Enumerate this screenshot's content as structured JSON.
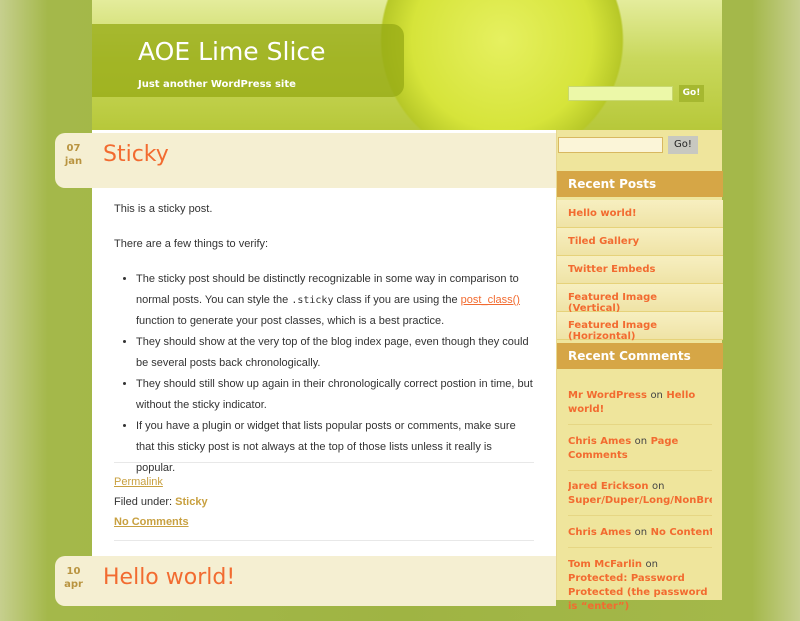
{
  "site": {
    "title": "AOE Lime Slice",
    "tagline": "Just another WordPress site",
    "search_button": "Go!"
  },
  "posts": [
    {
      "day": "07",
      "month": "jan",
      "title": "Sticky",
      "intro": "This is a sticky post.",
      "lead": "There are a few things to verify:",
      "bullets": {
        "b1_pre": "The sticky post should be distinctly recognizable in some way in comparison to normal posts. You can style the ",
        "b1_code": ".sticky",
        "b1_mid": " class if you are using the ",
        "b1_link": "post_class()",
        "b1_post": " function to generate your post classes, which is a best practice.",
        "b2": "They should show at the very top of the blog index page, even though they could be several posts back chronologically.",
        "b3": "They should still show up again in their chronologically correct postion in time, but without the sticky indicator.",
        "b4": "If you have a plugin or widget that lists popular posts or comments, make sure that this sticky post is not always at the top of those lists unless it really is popular."
      },
      "permalink": "Permalink",
      "filed_label": "Filed under:",
      "category": "Sticky",
      "comments": "No Comments"
    },
    {
      "day": "10",
      "month": "apr",
      "title": "Hello world!"
    }
  ],
  "sidebar": {
    "search_button": "Go!",
    "recent_posts_title": "Recent Posts",
    "recent_posts": [
      "Hello world!",
      "Tiled Gallery",
      "Twitter Embeds",
      "Featured Image (Vertical)",
      "Featured Image (Horizontal)"
    ],
    "recent_comments_title": "Recent Comments",
    "comments": [
      {
        "author": "Mr WordPress",
        "on": "on",
        "post": "Hello world!"
      },
      {
        "author": "Chris Ames",
        "on": "on",
        "post": "Page Comments"
      },
      {
        "author": "Jared Erickson",
        "on": "on",
        "post": "Super/Duper/Long/NonBreakingPostTitle"
      },
      {
        "author": "Chris Ames",
        "on": "on",
        "post": "No Content"
      },
      {
        "author": "Tom McFarlin",
        "on": "on",
        "post": "Protected: Password Protected (the password is “enter”)"
      }
    ]
  }
}
